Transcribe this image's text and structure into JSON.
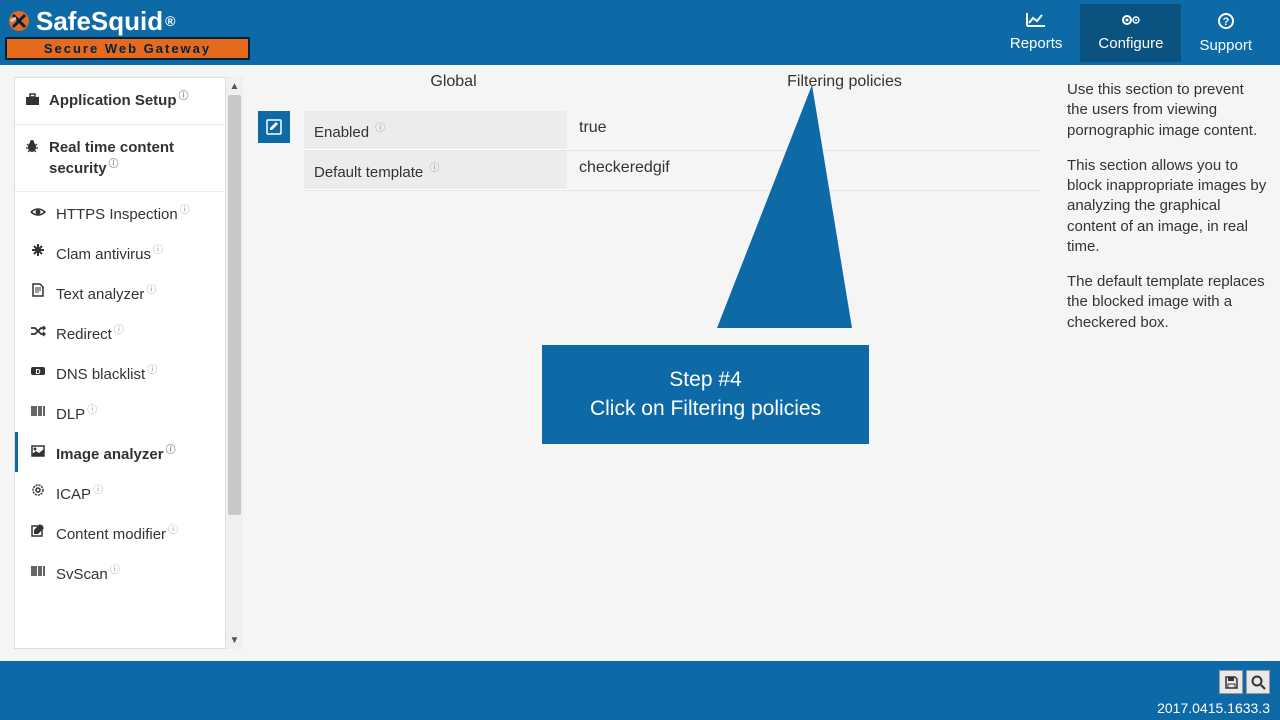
{
  "header": {
    "logo_text": "SafeSquid",
    "logo_reg": "®",
    "logo_tagline": "Secure Web Gateway",
    "nav": [
      {
        "label": "Reports",
        "icon": "chart"
      },
      {
        "label": "Configure",
        "icon": "cogs",
        "active": true
      },
      {
        "label": "Support",
        "icon": "help"
      }
    ]
  },
  "sidebar": {
    "sections": [
      {
        "label": "Application Setup",
        "icon": "briefcase"
      },
      {
        "label": "Real time content security",
        "icon": "bug"
      }
    ],
    "items": [
      {
        "label": "HTTPS Inspection",
        "icon": "eye"
      },
      {
        "label": "Clam antivirus",
        "icon": "asterisk"
      },
      {
        "label": "Text analyzer",
        "icon": "file"
      },
      {
        "label": "Redirect",
        "icon": "shuffle"
      },
      {
        "label": "DNS blacklist",
        "icon": "dns"
      },
      {
        "label": "DLP",
        "icon": "barcode"
      },
      {
        "label": "Image analyzer",
        "icon": "image",
        "active": true
      },
      {
        "label": "ICAP",
        "icon": "gear"
      },
      {
        "label": "Content modifier",
        "icon": "edit"
      },
      {
        "label": "SvScan",
        "icon": "barcode"
      }
    ]
  },
  "tabs": [
    {
      "label": "Global"
    },
    {
      "label": "Filtering policies"
    }
  ],
  "config": [
    {
      "label": "Enabled",
      "value": "true"
    },
    {
      "label": "Default template",
      "value": "checkeredgif"
    }
  ],
  "help": {
    "p1": "Use this section to prevent the users from viewing pornographic image content.",
    "p2": "This section allows you to block inappropriate images by analyzing the graphical content of an image, in real time.",
    "p3": "The default template replaces the blocked image with a checkered box."
  },
  "callout": {
    "line1": "Step #4",
    "line2": "Click on Filtering policies"
  },
  "footer": {
    "version": "2017.0415.1633.3"
  }
}
